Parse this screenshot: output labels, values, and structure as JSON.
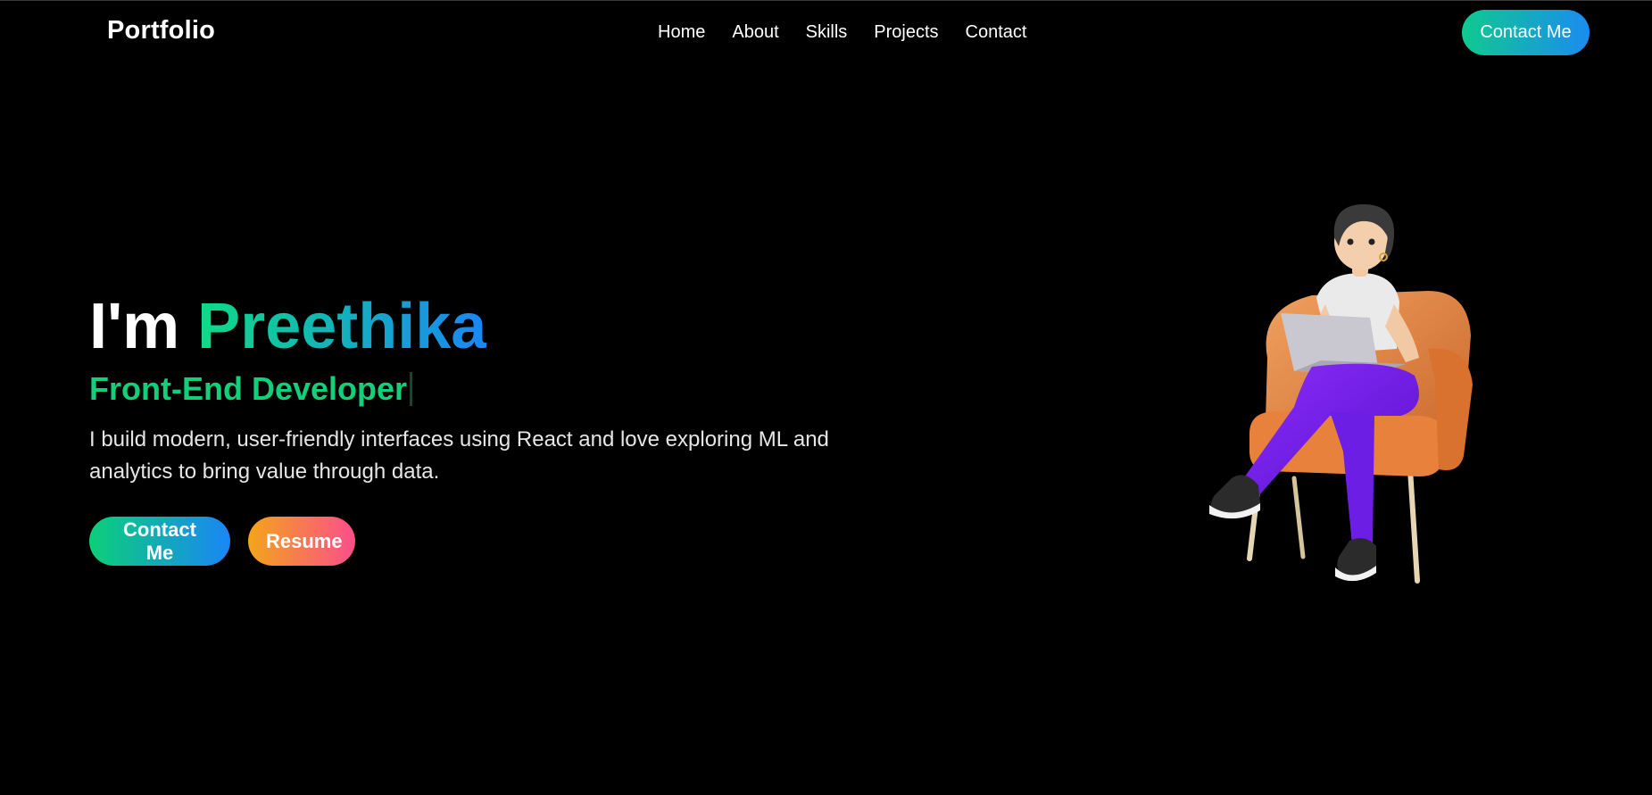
{
  "header": {
    "logo": "Portfolio",
    "nav": [
      {
        "label": "Home"
      },
      {
        "label": "About"
      },
      {
        "label": "Skills"
      },
      {
        "label": "Projects"
      },
      {
        "label": "Contact"
      }
    ],
    "cta_label": "Contact Me"
  },
  "hero": {
    "greeting": "I'm",
    "name": "Preethika",
    "role": "Front-End Developer",
    "description": "I build modern, user-friendly interfaces using React and love exploring ML and analytics to bring value through data.",
    "buttons": {
      "contact_label": "Contact Me",
      "resume_label": "Resume"
    }
  },
  "colors": {
    "background": "#000000",
    "accent_green": "#0edb85",
    "accent_blue": "#1a86f5",
    "accent_orange": "#f3a51a",
    "accent_pink": "#fb4e8b"
  },
  "illustration": {
    "icon": "developer-avatar-illustration"
  }
}
